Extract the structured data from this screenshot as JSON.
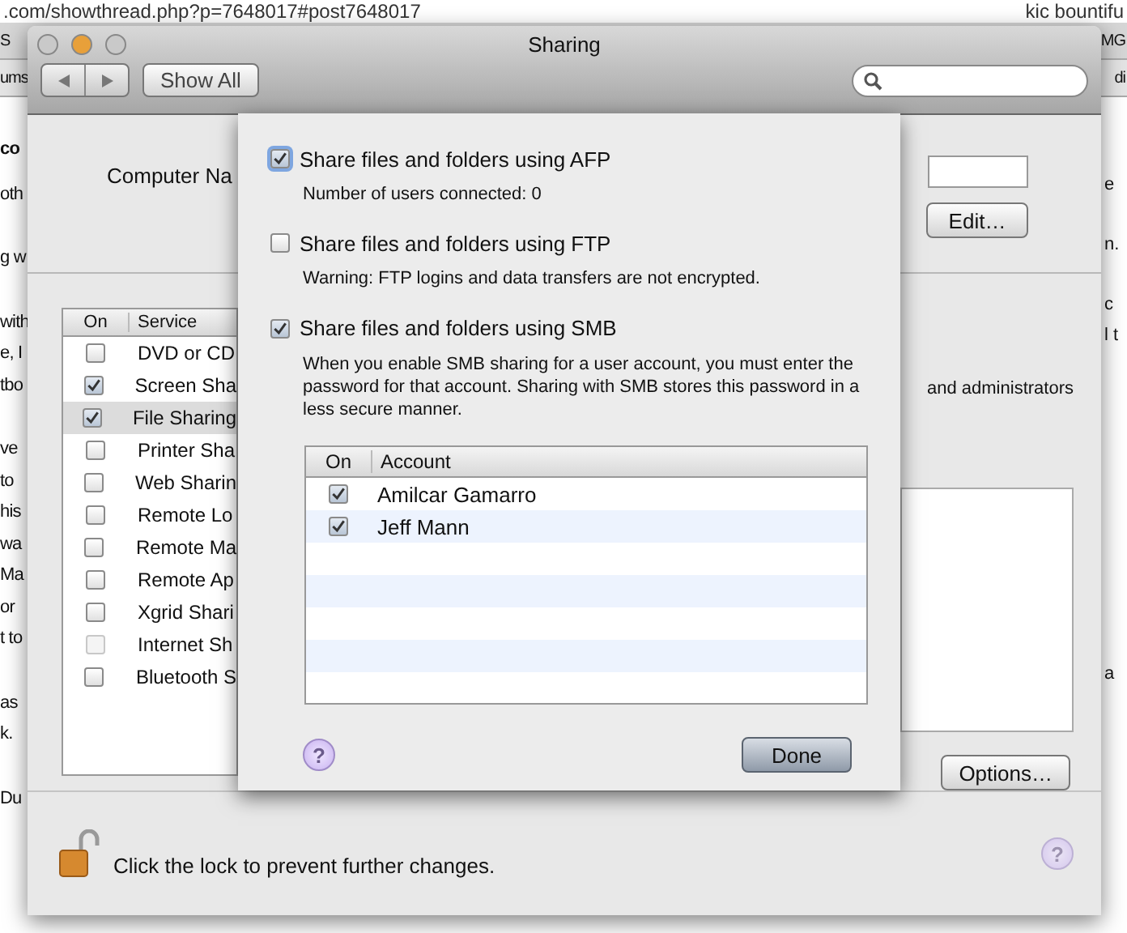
{
  "browser": {
    "address": ".com/showthread.php?p=7648017#post7648017",
    "search_value": "kic bountifu",
    "left_tabs": [
      "S",
      "ums"
    ],
    "right_tabs": [
      "MG",
      "di"
    ]
  },
  "background_page": {
    "left_paragraphs": [
      {
        "kind": "heading",
        "lines": [
          "co"
        ]
      },
      {
        "kind": "text",
        "lines": [
          "oth"
        ]
      },
      {
        "kind": "text",
        "lines": [
          "g w"
        ]
      },
      {
        "kind": "text",
        "lines": [
          "with",
          "e, I",
          "tbo"
        ]
      },
      {
        "kind": "text",
        "lines": [
          "ve",
          "to",
          "his",
          "wa",
          "Ma",
          "or",
          "t to"
        ]
      },
      {
        "kind": "text",
        "lines": [
          "as",
          "k."
        ]
      },
      {
        "kind": "text",
        "lines": [
          "Du"
        ]
      }
    ],
    "right_paragraphs": [
      [
        "e"
      ],
      [
        "n."
      ],
      [
        "c",
        "l t"
      ],
      [
        "a"
      ]
    ]
  },
  "window": {
    "title": "Sharing",
    "traffic_lights": [
      {
        "color": "#c9c9c9"
      },
      {
        "color": "#e8a03a"
      },
      {
        "color": "#c9c9c9"
      }
    ],
    "show_all": "Show All",
    "computer_name_label": "Computer Na",
    "edit_button": "Edit…",
    "services": {
      "columns": [
        "On",
        "Service"
      ],
      "rows": [
        {
          "name": "DVD or CD",
          "on": false,
          "selected": false,
          "disabled": false
        },
        {
          "name": "Screen Sha",
          "on": true,
          "selected": false,
          "disabled": false
        },
        {
          "name": "File Sharing",
          "on": true,
          "selected": true,
          "disabled": false
        },
        {
          "name": "Printer Sha",
          "on": false,
          "selected": false,
          "disabled": false
        },
        {
          "name": "Web Sharin",
          "on": false,
          "selected": false,
          "disabled": false
        },
        {
          "name": "Remote Lo",
          "on": false,
          "selected": false,
          "disabled": false
        },
        {
          "name": "Remote Ma",
          "on": false,
          "selected": false,
          "disabled": false
        },
        {
          "name": "Remote Ap",
          "on": false,
          "selected": false,
          "disabled": false
        },
        {
          "name": "Xgrid Shari",
          "on": false,
          "selected": false,
          "disabled": false
        },
        {
          "name": "Internet Sh",
          "on": false,
          "selected": false,
          "disabled": true
        },
        {
          "name": "Bluetooth S",
          "on": false,
          "selected": false,
          "disabled": false
        }
      ]
    },
    "access_text": "and administrators",
    "options_button": "Options…",
    "help_label": "?",
    "lock_text": "Click the lock to prevent further changes."
  },
  "sheet": {
    "options": [
      {
        "label": "Share files and folders using AFP",
        "checked": true,
        "focused": true,
        "note": "Number of users connected: 0"
      },
      {
        "label": "Share files and folders using FTP",
        "checked": false,
        "focused": false,
        "note": "Warning: FTP logins and data transfers are not encrypted."
      },
      {
        "label": "Share files and folders using SMB",
        "checked": true,
        "focused": false,
        "note": "When you enable SMB sharing for a user account, you must enter the password for that account. Sharing with SMB stores this password in a less secure manner."
      }
    ],
    "accounts": {
      "columns": [
        "On",
        "Account"
      ],
      "rows": [
        {
          "name": "Amilcar Gamarro",
          "on": true
        },
        {
          "name": "Jeff Mann",
          "on": true
        }
      ]
    },
    "help_label": "?",
    "done_button": "Done"
  }
}
